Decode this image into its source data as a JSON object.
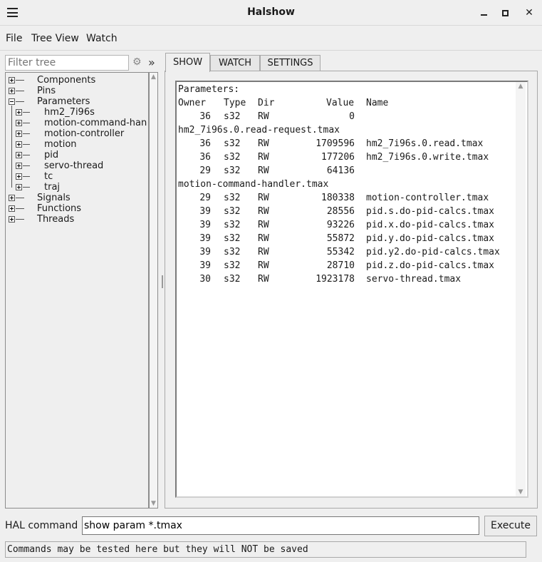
{
  "window": {
    "title": "Halshow"
  },
  "menu": {
    "items": [
      "File",
      "Tree View",
      "Watch"
    ]
  },
  "tree": {
    "filter_placeholder": "Filter tree",
    "expand_all_glyph": "»",
    "nodes": [
      {
        "label": "Components",
        "level": 0,
        "expanded": false
      },
      {
        "label": "Pins",
        "level": 0,
        "expanded": false
      },
      {
        "label": "Parameters",
        "level": 0,
        "expanded": true
      },
      {
        "label": "hm2_7i96s",
        "level": 1,
        "expanded": false
      },
      {
        "label": "motion-command-han",
        "level": 1,
        "expanded": false
      },
      {
        "label": "motion-controller",
        "level": 1,
        "expanded": false
      },
      {
        "label": "motion",
        "level": 1,
        "expanded": false
      },
      {
        "label": "pid",
        "level": 1,
        "expanded": false
      },
      {
        "label": "servo-thread",
        "level": 1,
        "expanded": false
      },
      {
        "label": "tc",
        "level": 1,
        "expanded": false
      },
      {
        "label": "traj",
        "level": 1,
        "expanded": false
      },
      {
        "label": "Signals",
        "level": 0,
        "expanded": false
      },
      {
        "label": "Functions",
        "level": 0,
        "expanded": false
      },
      {
        "label": "Threads",
        "level": 0,
        "expanded": false
      }
    ]
  },
  "tabs": [
    {
      "label": "SHOW",
      "active": true
    },
    {
      "label": "WATCH",
      "active": false
    },
    {
      "label": "SETTINGS",
      "active": false
    }
  ],
  "output": {
    "heading": "Parameters:",
    "columns": [
      "Owner",
      "Type",
      "Dir",
      "Value",
      "Name"
    ],
    "lines": [
      {
        "owner": "36",
        "type": "s32",
        "dir": "RW",
        "value": "0",
        "name": ""
      },
      {
        "wrap": "hm2_7i96s.0.read-request.tmax"
      },
      {
        "owner": "36",
        "type": "s32",
        "dir": "RW",
        "value": "1709596",
        "name": "hm2_7i96s.0.read.tmax"
      },
      {
        "owner": "36",
        "type": "s32",
        "dir": "RW",
        "value": "177206",
        "name": "hm2_7i96s.0.write.tmax"
      },
      {
        "owner": "29",
        "type": "s32",
        "dir": "RW",
        "value": "64136",
        "name": ""
      },
      {
        "wrap": "motion-command-handler.tmax"
      },
      {
        "owner": "29",
        "type": "s32",
        "dir": "RW",
        "value": "180338",
        "name": "motion-controller.tmax"
      },
      {
        "owner": "39",
        "type": "s32",
        "dir": "RW",
        "value": "28556",
        "name": "pid.s.do-pid-calcs.tmax"
      },
      {
        "owner": "39",
        "type": "s32",
        "dir": "RW",
        "value": "93226",
        "name": "pid.x.do-pid-calcs.tmax"
      },
      {
        "owner": "39",
        "type": "s32",
        "dir": "RW",
        "value": "55872",
        "name": "pid.y.do-pid-calcs.tmax"
      },
      {
        "owner": "39",
        "type": "s32",
        "dir": "RW",
        "value": "55342",
        "name": "pid.y2.do-pid-calcs.tmax"
      },
      {
        "owner": "39",
        "type": "s32",
        "dir": "RW",
        "value": "28710",
        "name": "pid.z.do-pid-calcs.tmax"
      },
      {
        "owner": "30",
        "type": "s32",
        "dir": "RW",
        "value": "1923178",
        "name": "servo-thread.tmax"
      }
    ]
  },
  "command": {
    "label": "HAL command :",
    "value": "show param *.tmax",
    "execute_label": "Execute"
  },
  "status": {
    "text": "Commands may be tested here but they will NOT be saved"
  }
}
